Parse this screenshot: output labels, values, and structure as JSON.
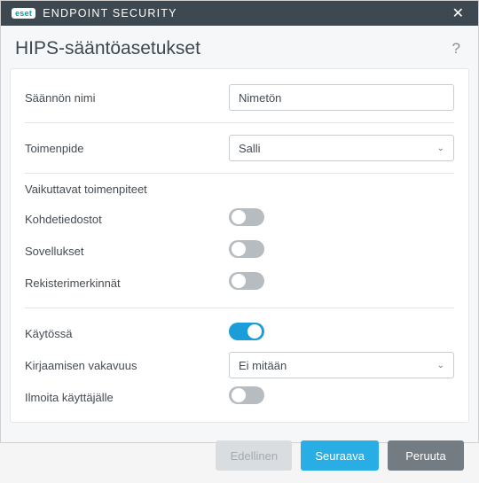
{
  "app": {
    "brand_badge": "eset",
    "brand_text": "ENDPOINT SECURITY"
  },
  "header": {
    "title": "HIPS-sääntöasetukset"
  },
  "form": {
    "rule_name": {
      "label": "Säännön nimi",
      "value": "Nimetön"
    },
    "action": {
      "label": "Toimenpide",
      "value": "Salli"
    },
    "affecting_section": "Vaikuttavat toimenpiteet",
    "target_files": {
      "label": "Kohdetiedostot",
      "on": false
    },
    "applications": {
      "label": "Sovellukset",
      "on": false
    },
    "registry": {
      "label": "Rekisterimerkinnät",
      "on": false
    },
    "enabled": {
      "label": "Käytössä",
      "on": true
    },
    "severity": {
      "label": "Kirjaamisen vakavuus",
      "value": "Ei mitään"
    },
    "notify": {
      "label": "Ilmoita käyttäjälle",
      "on": false
    }
  },
  "footer": {
    "prev": "Edellinen",
    "next": "Seuraava",
    "cancel": "Peruuta"
  }
}
